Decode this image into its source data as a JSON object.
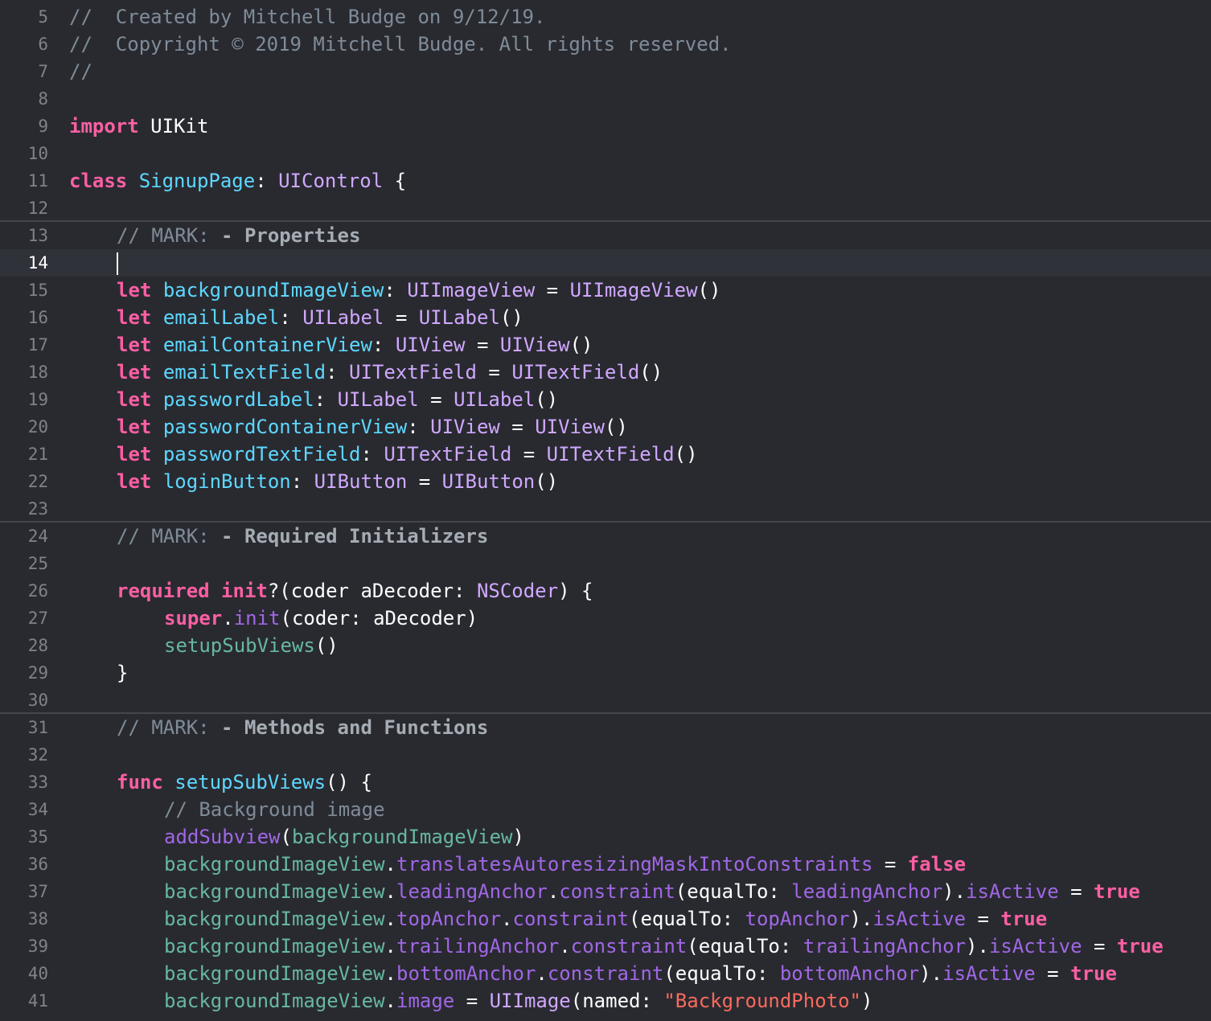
{
  "editor": {
    "colors": {
      "background": "#292a30",
      "current_line": "#2f3239",
      "line_number": "#7f8389",
      "comment": "#7f8c98",
      "keyword": "#fc5fa3",
      "declaration": "#5dd8ff",
      "type": "#d0a8ff",
      "property": "#67b7a4",
      "method": "#a167e6",
      "string": "#fc6a5d",
      "plain": "#ffffff"
    },
    "current_line": "14",
    "lines": [
      {
        "n": "5",
        "indent": 0,
        "tokens": [
          {
            "t": "comment",
            "v": "//  Created by Mitchell Budge on 9/12/19."
          }
        ]
      },
      {
        "n": "6",
        "indent": 0,
        "tokens": [
          {
            "t": "comment",
            "v": "//  Copyright © 2019 Mitchell Budge. All rights reserved."
          }
        ]
      },
      {
        "n": "7",
        "indent": 0,
        "tokens": [
          {
            "t": "comment",
            "v": "//"
          }
        ]
      },
      {
        "n": "8",
        "indent": 0,
        "tokens": []
      },
      {
        "n": "9",
        "indent": 0,
        "tokens": [
          {
            "t": "keyword",
            "v": "import"
          },
          {
            "t": "plain",
            "v": " UIKit"
          }
        ]
      },
      {
        "n": "10",
        "indent": 0,
        "tokens": []
      },
      {
        "n": "11",
        "indent": 0,
        "tokens": [
          {
            "t": "keyword",
            "v": "class"
          },
          {
            "t": "plain",
            "v": " "
          },
          {
            "t": "decl",
            "v": "SignupPage"
          },
          {
            "t": "plain",
            "v": ": "
          },
          {
            "t": "type",
            "v": "UIControl"
          },
          {
            "t": "plain",
            "v": " {"
          }
        ]
      },
      {
        "n": "12",
        "indent": 0,
        "tokens": []
      },
      {
        "n": "13",
        "indent": 1,
        "mark": true,
        "tokens": [
          {
            "t": "comment",
            "v": "// MARK: "
          },
          {
            "t": "mark",
            "v": "- Properties"
          }
        ]
      },
      {
        "n": "14",
        "indent": 1,
        "current": true,
        "cursor": true,
        "tokens": []
      },
      {
        "n": "15",
        "indent": 1,
        "tokens": [
          {
            "t": "keyword",
            "v": "let"
          },
          {
            "t": "plain",
            "v": " "
          },
          {
            "t": "decl",
            "v": "backgroundImageView"
          },
          {
            "t": "plain",
            "v": ": "
          },
          {
            "t": "type",
            "v": "UIImageView"
          },
          {
            "t": "plain",
            "v": " = "
          },
          {
            "t": "type",
            "v": "UIImageView"
          },
          {
            "t": "plain",
            "v": "()"
          }
        ]
      },
      {
        "n": "16",
        "indent": 1,
        "tokens": [
          {
            "t": "keyword",
            "v": "let"
          },
          {
            "t": "plain",
            "v": " "
          },
          {
            "t": "decl",
            "v": "emailLabel"
          },
          {
            "t": "plain",
            "v": ": "
          },
          {
            "t": "type",
            "v": "UILabel"
          },
          {
            "t": "plain",
            "v": " = "
          },
          {
            "t": "type",
            "v": "UILabel"
          },
          {
            "t": "plain",
            "v": "()"
          }
        ]
      },
      {
        "n": "17",
        "indent": 1,
        "tokens": [
          {
            "t": "keyword",
            "v": "let"
          },
          {
            "t": "plain",
            "v": " "
          },
          {
            "t": "decl",
            "v": "emailContainerView"
          },
          {
            "t": "plain",
            "v": ": "
          },
          {
            "t": "type",
            "v": "UIView"
          },
          {
            "t": "plain",
            "v": " = "
          },
          {
            "t": "type",
            "v": "UIView"
          },
          {
            "t": "plain",
            "v": "()"
          }
        ]
      },
      {
        "n": "18",
        "indent": 1,
        "tokens": [
          {
            "t": "keyword",
            "v": "let"
          },
          {
            "t": "plain",
            "v": " "
          },
          {
            "t": "decl",
            "v": "emailTextField"
          },
          {
            "t": "plain",
            "v": ": "
          },
          {
            "t": "type",
            "v": "UITextField"
          },
          {
            "t": "plain",
            "v": " = "
          },
          {
            "t": "type",
            "v": "UITextField"
          },
          {
            "t": "plain",
            "v": "()"
          }
        ]
      },
      {
        "n": "19",
        "indent": 1,
        "tokens": [
          {
            "t": "keyword",
            "v": "let"
          },
          {
            "t": "plain",
            "v": " "
          },
          {
            "t": "decl",
            "v": "passwordLabel"
          },
          {
            "t": "plain",
            "v": ": "
          },
          {
            "t": "type",
            "v": "UILabel"
          },
          {
            "t": "plain",
            "v": " = "
          },
          {
            "t": "type",
            "v": "UILabel"
          },
          {
            "t": "plain",
            "v": "()"
          }
        ]
      },
      {
        "n": "20",
        "indent": 1,
        "tokens": [
          {
            "t": "keyword",
            "v": "let"
          },
          {
            "t": "plain",
            "v": " "
          },
          {
            "t": "decl",
            "v": "passwordContainerView"
          },
          {
            "t": "plain",
            "v": ": "
          },
          {
            "t": "type",
            "v": "UIView"
          },
          {
            "t": "plain",
            "v": " = "
          },
          {
            "t": "type",
            "v": "UIView"
          },
          {
            "t": "plain",
            "v": "()"
          }
        ]
      },
      {
        "n": "21",
        "indent": 1,
        "tokens": [
          {
            "t": "keyword",
            "v": "let"
          },
          {
            "t": "plain",
            "v": " "
          },
          {
            "t": "decl",
            "v": "passwordTextField"
          },
          {
            "t": "plain",
            "v": ": "
          },
          {
            "t": "type",
            "v": "UITextField"
          },
          {
            "t": "plain",
            "v": " = "
          },
          {
            "t": "type",
            "v": "UITextField"
          },
          {
            "t": "plain",
            "v": "()"
          }
        ]
      },
      {
        "n": "22",
        "indent": 1,
        "tokens": [
          {
            "t": "keyword",
            "v": "let"
          },
          {
            "t": "plain",
            "v": " "
          },
          {
            "t": "decl",
            "v": "loginButton"
          },
          {
            "t": "plain",
            "v": ": "
          },
          {
            "t": "type",
            "v": "UIButton"
          },
          {
            "t": "plain",
            "v": " = "
          },
          {
            "t": "type",
            "v": "UIButton"
          },
          {
            "t": "plain",
            "v": "()"
          }
        ]
      },
      {
        "n": "23",
        "indent": 0,
        "tokens": []
      },
      {
        "n": "24",
        "indent": 1,
        "mark": true,
        "tokens": [
          {
            "t": "comment",
            "v": "// MARK: "
          },
          {
            "t": "mark",
            "v": "- Required Initializers"
          }
        ]
      },
      {
        "n": "25",
        "indent": 0,
        "tokens": []
      },
      {
        "n": "26",
        "indent": 1,
        "tokens": [
          {
            "t": "keyword",
            "v": "required"
          },
          {
            "t": "plain",
            "v": " "
          },
          {
            "t": "keyword",
            "v": "init"
          },
          {
            "t": "plain",
            "v": "?(coder aDecoder: "
          },
          {
            "t": "type",
            "v": "NSCoder"
          },
          {
            "t": "plain",
            "v": ") {"
          }
        ]
      },
      {
        "n": "27",
        "indent": 2,
        "tokens": [
          {
            "t": "keyword",
            "v": "super"
          },
          {
            "t": "plain",
            "v": "."
          },
          {
            "t": "method",
            "v": "init"
          },
          {
            "t": "plain",
            "v": "(coder: aDecoder)"
          }
        ]
      },
      {
        "n": "28",
        "indent": 2,
        "tokens": [
          {
            "t": "prop",
            "v": "setupSubViews"
          },
          {
            "t": "plain",
            "v": "()"
          }
        ]
      },
      {
        "n": "29",
        "indent": 1,
        "tokens": [
          {
            "t": "plain",
            "v": "}"
          }
        ]
      },
      {
        "n": "30",
        "indent": 0,
        "tokens": []
      },
      {
        "n": "31",
        "indent": 1,
        "mark": true,
        "tokens": [
          {
            "t": "comment",
            "v": "// MARK: "
          },
          {
            "t": "mark",
            "v": "- Methods and Functions"
          }
        ]
      },
      {
        "n": "32",
        "indent": 0,
        "tokens": []
      },
      {
        "n": "33",
        "indent": 1,
        "tokens": [
          {
            "t": "keyword",
            "v": "func"
          },
          {
            "t": "plain",
            "v": " "
          },
          {
            "t": "decl",
            "v": "setupSubViews"
          },
          {
            "t": "plain",
            "v": "() {"
          }
        ]
      },
      {
        "n": "34",
        "indent": 2,
        "tokens": [
          {
            "t": "comment",
            "v": "// Background image"
          }
        ]
      },
      {
        "n": "35",
        "indent": 2,
        "tokens": [
          {
            "t": "method",
            "v": "addSubview"
          },
          {
            "t": "plain",
            "v": "("
          },
          {
            "t": "prop",
            "v": "backgroundImageView"
          },
          {
            "t": "plain",
            "v": ")"
          }
        ]
      },
      {
        "n": "36",
        "indent": 2,
        "tokens": [
          {
            "t": "prop",
            "v": "backgroundImageView"
          },
          {
            "t": "plain",
            "v": "."
          },
          {
            "t": "method",
            "v": "translatesAutoresizingMaskIntoConstraints"
          },
          {
            "t": "plain",
            "v": " = "
          },
          {
            "t": "keyword",
            "v": "false"
          }
        ]
      },
      {
        "n": "37",
        "indent": 2,
        "tokens": [
          {
            "t": "prop",
            "v": "backgroundImageView"
          },
          {
            "t": "plain",
            "v": "."
          },
          {
            "t": "method",
            "v": "leadingAnchor"
          },
          {
            "t": "plain",
            "v": "."
          },
          {
            "t": "method",
            "v": "constraint"
          },
          {
            "t": "plain",
            "v": "(equalTo: "
          },
          {
            "t": "method",
            "v": "leadingAnchor"
          },
          {
            "t": "plain",
            "v": ")."
          },
          {
            "t": "method",
            "v": "isActive"
          },
          {
            "t": "plain",
            "v": " = "
          },
          {
            "t": "keyword",
            "v": "true"
          }
        ]
      },
      {
        "n": "38",
        "indent": 2,
        "tokens": [
          {
            "t": "prop",
            "v": "backgroundImageView"
          },
          {
            "t": "plain",
            "v": "."
          },
          {
            "t": "method",
            "v": "topAnchor"
          },
          {
            "t": "plain",
            "v": "."
          },
          {
            "t": "method",
            "v": "constraint"
          },
          {
            "t": "plain",
            "v": "(equalTo: "
          },
          {
            "t": "method",
            "v": "topAnchor"
          },
          {
            "t": "plain",
            "v": ")."
          },
          {
            "t": "method",
            "v": "isActive"
          },
          {
            "t": "plain",
            "v": " = "
          },
          {
            "t": "keyword",
            "v": "true"
          }
        ]
      },
      {
        "n": "39",
        "indent": 2,
        "tokens": [
          {
            "t": "prop",
            "v": "backgroundImageView"
          },
          {
            "t": "plain",
            "v": "."
          },
          {
            "t": "method",
            "v": "trailingAnchor"
          },
          {
            "t": "plain",
            "v": "."
          },
          {
            "t": "method",
            "v": "constraint"
          },
          {
            "t": "plain",
            "v": "(equalTo: "
          },
          {
            "t": "method",
            "v": "trailingAnchor"
          },
          {
            "t": "plain",
            "v": ")."
          },
          {
            "t": "method",
            "v": "isActive"
          },
          {
            "t": "plain",
            "v": " = "
          },
          {
            "t": "keyword",
            "v": "true"
          }
        ]
      },
      {
        "n": "40",
        "indent": 2,
        "tokens": [
          {
            "t": "prop",
            "v": "backgroundImageView"
          },
          {
            "t": "plain",
            "v": "."
          },
          {
            "t": "method",
            "v": "bottomAnchor"
          },
          {
            "t": "plain",
            "v": "."
          },
          {
            "t": "method",
            "v": "constraint"
          },
          {
            "t": "plain",
            "v": "(equalTo: "
          },
          {
            "t": "method",
            "v": "bottomAnchor"
          },
          {
            "t": "plain",
            "v": ")."
          },
          {
            "t": "method",
            "v": "isActive"
          },
          {
            "t": "plain",
            "v": " = "
          },
          {
            "t": "keyword",
            "v": "true"
          }
        ]
      },
      {
        "n": "41",
        "indent": 2,
        "tokens": [
          {
            "t": "prop",
            "v": "backgroundImageView"
          },
          {
            "t": "plain",
            "v": "."
          },
          {
            "t": "method",
            "v": "image"
          },
          {
            "t": "plain",
            "v": " = "
          },
          {
            "t": "type",
            "v": "UIImage"
          },
          {
            "t": "plain",
            "v": "(named: "
          },
          {
            "t": "string",
            "v": "\"BackgroundPhoto\""
          },
          {
            "t": "plain",
            "v": ")"
          }
        ]
      }
    ]
  }
}
